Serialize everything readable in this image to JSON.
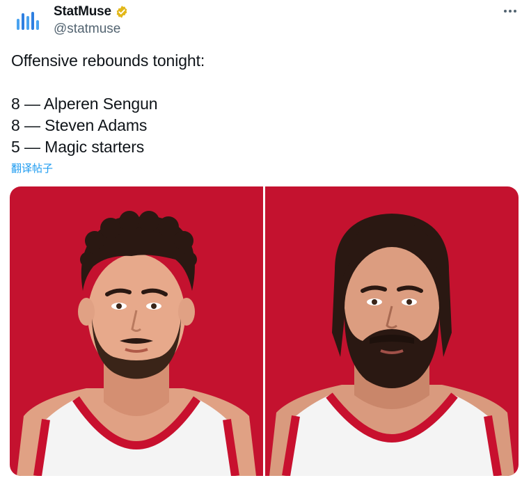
{
  "tweet": {
    "display_name": "StatMuse",
    "verified_badge": "verified-badge-icon",
    "handle": "@statmuse",
    "text_lines": [
      "Offensive rebounds tonight:",
      "",
      "8 — Alperen Sengun",
      "8 — Steven Adams",
      "5 — Magic starters"
    ],
    "translate_label": "翻译帖子"
  },
  "media": {
    "background_color": "#c4122f",
    "images": [
      "player-portrait-sengun",
      "player-portrait-adams"
    ]
  },
  "colors": {
    "link": "#1d9bf0",
    "badge": "#e2b719",
    "logo_blue": "#3b82f6",
    "jersey_red": "#c8102e"
  }
}
